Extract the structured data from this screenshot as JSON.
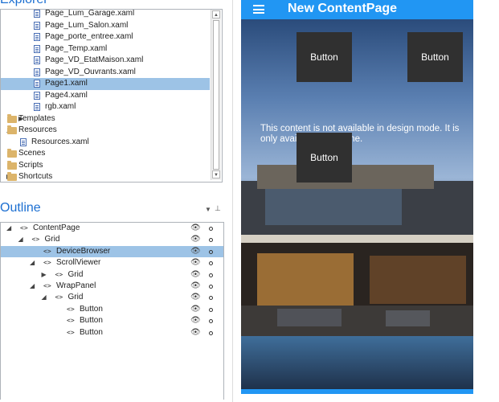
{
  "explorer": {
    "title": "Explorer",
    "items": [
      {
        "label": "Page_Lum_Garage.xaml",
        "type": "file",
        "selected": false
      },
      {
        "label": "Page_Lum_Salon.xaml",
        "type": "file",
        "selected": false
      },
      {
        "label": "Page_porte_entree.xaml",
        "type": "file",
        "selected": false
      },
      {
        "label": "Page_Temp.xaml",
        "type": "file",
        "selected": false
      },
      {
        "label": "Page_VD_EtatMaison.xaml",
        "type": "file",
        "selected": false
      },
      {
        "label": "Page_VD_Ouvrants.xaml",
        "type": "file",
        "selected": false
      },
      {
        "label": "Page1.xaml",
        "type": "file",
        "selected": true
      },
      {
        "label": "Page4.xaml",
        "type": "file",
        "selected": false
      },
      {
        "label": "rgb.xaml",
        "type": "file",
        "selected": false
      },
      {
        "label": "Templates",
        "type": "folder",
        "expander": "collapsed",
        "selected": false
      },
      {
        "label": "Resources",
        "type": "folder-open",
        "expander": "expanded",
        "selected": false
      },
      {
        "label": "Resources.xaml",
        "type": "file",
        "selected": false
      },
      {
        "label": "Scenes",
        "type": "folder",
        "expander": "none",
        "selected": false
      },
      {
        "label": "Scripts",
        "type": "folder",
        "expander": "none",
        "selected": false
      },
      {
        "label": "Shortcuts",
        "type": "folder",
        "expander": "collapsed",
        "selected": false
      }
    ]
  },
  "outline": {
    "title": "Outline",
    "items": [
      {
        "tag": "<>",
        "label": "ContentPage",
        "expander": "expanded",
        "selected": false
      },
      {
        "tag": "<>",
        "label": "Grid",
        "expander": "expanded",
        "selected": false
      },
      {
        "tag": "<>",
        "label": "DeviceBrowser",
        "expander": "none",
        "selected": true
      },
      {
        "tag": "<>",
        "label": "ScrollViewer",
        "expander": "expanded",
        "selected": false
      },
      {
        "tag": "<>",
        "label": "Grid",
        "expander": "collapsed",
        "selected": false
      },
      {
        "tag": "<>",
        "label": "WrapPanel",
        "expander": "expanded",
        "selected": false
      },
      {
        "tag": "<>",
        "label": "Grid",
        "expander": "expanded",
        "selected": false
      },
      {
        "tag": "<>",
        "label": "Button",
        "expander": "none",
        "selected": false
      },
      {
        "tag": "<>",
        "label": "Button",
        "expander": "none",
        "selected": false
      },
      {
        "tag": "<>",
        "label": "Button",
        "expander": "none",
        "selected": false
      }
    ]
  },
  "preview": {
    "app_title": "New ContentPage",
    "buttons": [
      "Button",
      "Button",
      "Button"
    ],
    "design_message": "This content is not available in design mode. It is only available at runtime.",
    "accent": "#2196f3"
  }
}
